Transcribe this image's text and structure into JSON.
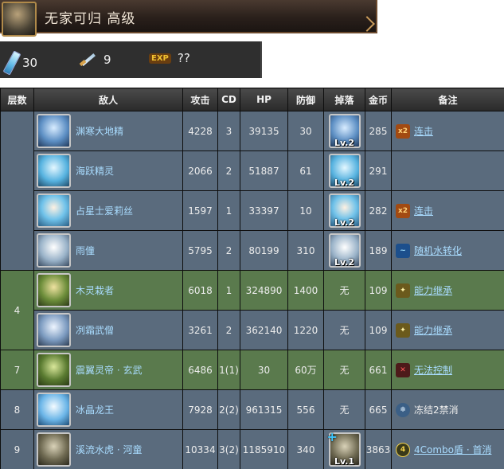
{
  "header": {
    "title": "无家可归 高级"
  },
  "stats": {
    "stamina": "30",
    "battles": "9",
    "exp_label": "EXP",
    "exp": "??"
  },
  "table": {
    "columns": [
      "层数",
      "敌人",
      "攻击",
      "CD",
      "HP",
      "防御",
      "掉落",
      "金币",
      "备注"
    ],
    "rows": [
      {
        "floor": "",
        "name": "渊寒大地精",
        "atk": "4228",
        "cd": "3",
        "hp": "39135",
        "def": "30",
        "drop": "Lv.2",
        "gold": "285",
        "note_icon": "combo-x2-icon",
        "note": "连击",
        "note_link": true
      },
      {
        "floor": "",
        "name": "海跃精灵",
        "atk": "2066",
        "cd": "2",
        "hp": "51887",
        "def": "61",
        "drop": "Lv.2",
        "gold": "291",
        "note_icon": "",
        "note": "",
        "note_link": false
      },
      {
        "floor": "",
        "name": "占星士爱莉丝",
        "atk": "1597",
        "cd": "1",
        "hp": "33397",
        "def": "10",
        "drop": "Lv.2",
        "gold": "282",
        "note_icon": "combo-x2-icon",
        "note": "连击",
        "note_link": true
      },
      {
        "floor": "",
        "name": "雨僮",
        "atk": "5795",
        "cd": "2",
        "hp": "80199",
        "def": "310",
        "drop": "Lv.2",
        "gold": "189",
        "note_icon": "water-convert-icon",
        "note": "随机水转化",
        "note_link": true
      },
      {
        "floor": "4",
        "name": "木灵栽者",
        "atk": "6018",
        "cd": "1",
        "hp": "324890",
        "def": "1400",
        "drop": "无",
        "gold": "109",
        "note_icon": "inherit-icon",
        "note": "能力继承",
        "note_link": true
      },
      {
        "floor": "",
        "name": "冽霜武僧",
        "atk": "3261",
        "cd": "2",
        "hp": "362140",
        "def": "1220",
        "drop": "无",
        "gold": "109",
        "note_icon": "inherit-icon",
        "note": "能力继承",
        "note_link": true
      },
      {
        "floor": "7",
        "name": "震翼灵帝 · 玄武",
        "atk": "6486",
        "cd": "1(1)",
        "hp": "30",
        "def": "60万",
        "drop": "无",
        "gold": "661",
        "note_icon": "stat-x-icon",
        "note": "无法控制",
        "note_link": true
      },
      {
        "floor": "8",
        "name": "冰晶龙王",
        "atk": "7928",
        "cd": "2(2)",
        "hp": "961315",
        "def": "556",
        "drop": "无",
        "gold": "665",
        "note_icon": "freeze-icon",
        "note": "冻结2禁消",
        "note_link": false
      },
      {
        "floor": "9",
        "name": "溪流水虎 · 河童",
        "atk": "10334",
        "cd": "3(2)",
        "hp": "1185910",
        "def": "340",
        "drop": "Lv.1",
        "gold": "3863",
        "note_icon": "four-combo-shield-icon",
        "note": "4Combo盾 · 首消",
        "note_link": true
      }
    ]
  },
  "colors": {
    "header_bg": "#2a201b",
    "row_blue": "#5a6b7d",
    "row_green": "#5a7a4d",
    "link_blue": "#a9dcff"
  }
}
